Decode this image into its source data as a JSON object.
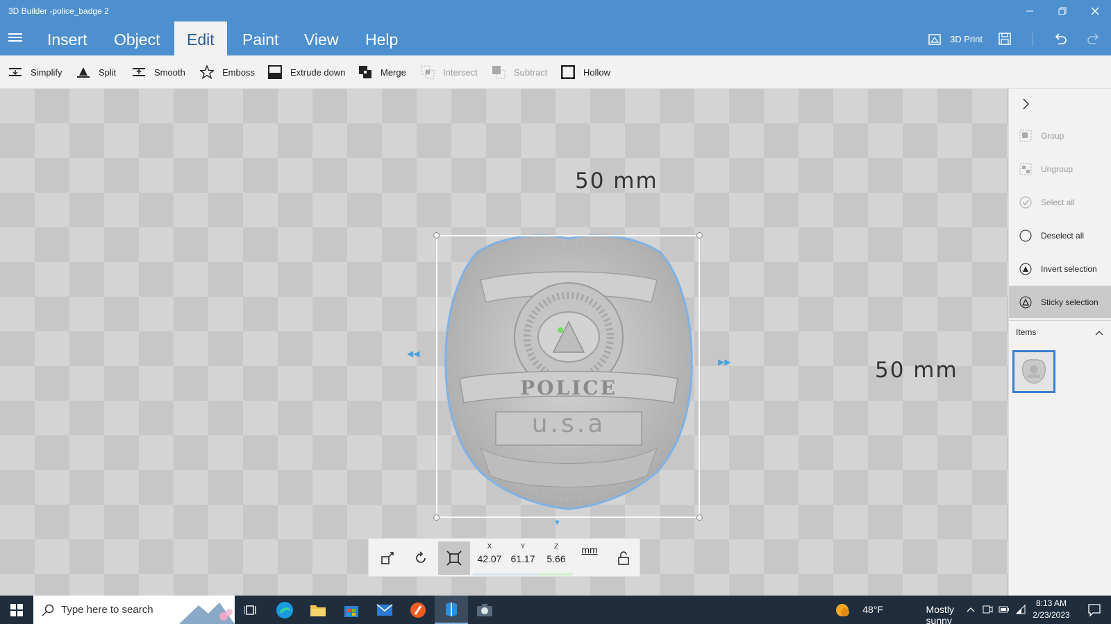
{
  "window": {
    "title": "3D Builder -police_badge 2"
  },
  "menu": {
    "items": [
      "Insert",
      "Object",
      "Edit",
      "Paint",
      "View",
      "Help"
    ],
    "active": "Edit",
    "print_label": "3D Print"
  },
  "toolbar": {
    "simplify": "Simplify",
    "split": "Split",
    "smooth": "Smooth",
    "emboss": "Emboss",
    "extrude_down": "Extrude down",
    "merge": "Merge",
    "intersect": "Intersect",
    "subtract": "Subtract",
    "hollow": "Hollow"
  },
  "viewport": {
    "dim_top": "50 mm",
    "dim_right": "50 mm",
    "badge_text_1": "POLICE",
    "badge_text_2": "u.s.a"
  },
  "transform": {
    "x_label": "X",
    "y_label": "Y",
    "z_label": "Z",
    "x_value": "42.07",
    "y_value": "61.17",
    "z_value": "5.66",
    "unit": "mm"
  },
  "right_panel": {
    "group": "Group",
    "ungroup": "Ungroup",
    "select_all": "Select all",
    "deselect_all": "Deselect all",
    "invert_selection": "Invert selection",
    "sticky_selection": "Sticky selection",
    "items_header": "Items"
  },
  "taskbar": {
    "search_placeholder": "Type here to search",
    "weather_temp": "48°F",
    "weather_desc": "Mostly sunny",
    "time": "8:13 AM",
    "date": "2/23/2023"
  },
  "colors": {
    "accent": "#4d8fcf",
    "selection_outline": "#7fb2e5",
    "taskbar": "#1f2d3d"
  }
}
